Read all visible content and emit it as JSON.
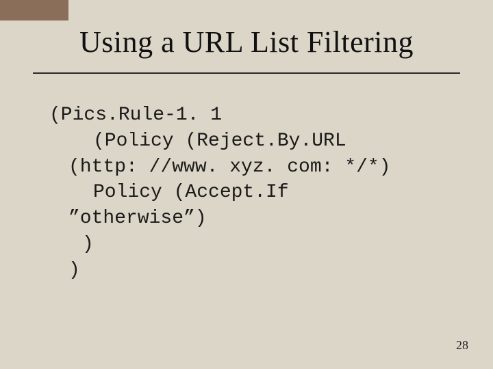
{
  "title": "Using a URL List Filtering",
  "code": {
    "l1": "(Pics.Rule-1. 1",
    "l2a": "(Policy (Reject.By.URL",
    "l2b": "(http: //www. xyz. com: */*)",
    "l3a": "Policy (Accept.If",
    "l3b": "”otherwise”)",
    "l3c": ")",
    "l4": ")"
  },
  "page_number": "28"
}
